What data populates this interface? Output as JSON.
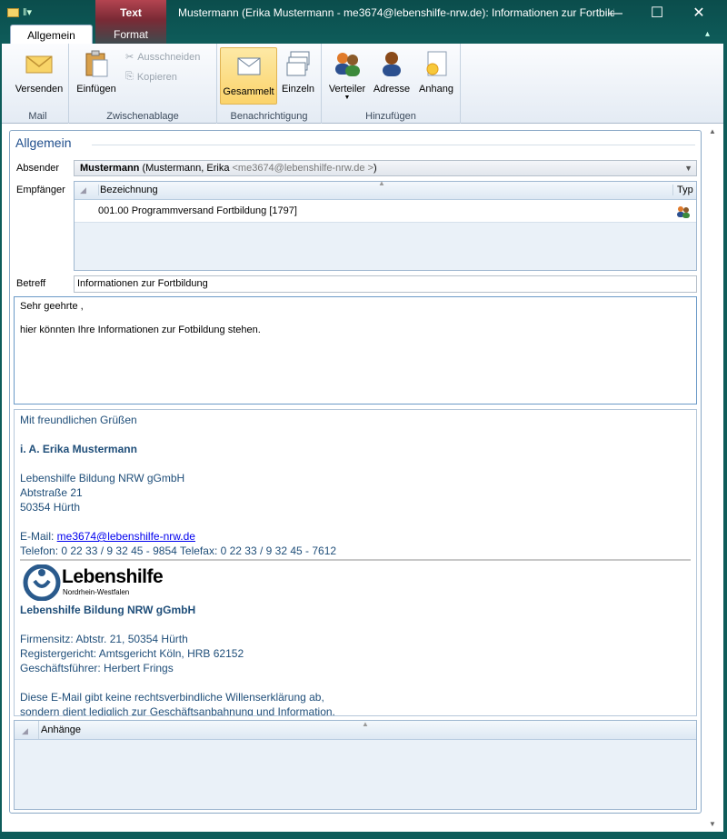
{
  "window": {
    "title": "Mustermann (Erika Mustermann - me3674@lebenshilfe-nrw.de): Informationen zur Fortbild...",
    "context_tab": "Text",
    "minimize": "—",
    "maximize": "☐",
    "close": "✕"
  },
  "tabs": {
    "allgemein": "Allgemein",
    "format": "Format"
  },
  "ribbon": {
    "mail": {
      "label": "Mail",
      "versenden": "Versenden"
    },
    "clipboard": {
      "label": "Zwischenablage",
      "einfuegen": "Einfügen",
      "ausschneiden": "Ausschneiden",
      "kopieren": "Kopieren"
    },
    "notify": {
      "label": "Benachrichtigung",
      "gesammelt": "Gesammelt",
      "einzeln": "Einzeln"
    },
    "add": {
      "label": "Hinzufügen",
      "verteiler": "Verteiler",
      "adresse": "Adresse",
      "anhang": "Anhang"
    }
  },
  "form": {
    "section_title": "Allgemein",
    "sender_label": "Absender",
    "sender_name": "Mustermann",
    "sender_detail": " (Mustermann, Erika ",
    "sender_addr": "<me3674@lebenshilfe-nrw.de >",
    "sender_close": ")",
    "recipient_label": "Empfänger",
    "col_bezeichnung": "Bezeichnung",
    "col_typ": "Typ",
    "recipient_row": "001.00 Programmversand Fortbildung [1797]",
    "subject_label": "Betreff",
    "subject_value": "Informationen zur Fortbildung",
    "body_line1": "Sehr geehrte ,",
    "body_line2": "hier könnten Ihre Informationen zur Fotbildung stehen.",
    "attachments_label": "Anhänge"
  },
  "signature": {
    "greeting": "Mit freundlichen Grüßen",
    "name": "i. A. Erika Mustermann",
    "org": "Lebenshilfe Bildung NRW gGmbH",
    "street": "Abtstraße 21",
    "city": "50354 Hürth",
    "email_label": "E-Mail:  ",
    "email": "me3674@lebenshilfe-nrw.de",
    "phone": "Telefon: 0 22 33 / 9 32 45 - 9854 Telefax: 0 22 33 / 9 32 45 - 7612",
    "logo_text": "Lebenshilfe",
    "logo_sub": "Nordrhein-Westfalen",
    "org_bold": "Lebenshilfe Bildung NRW gGmbH",
    "seat": "Firmensitz: Abtstr. 21, 50354 Hürth",
    "register": "Registergericht: Amtsgericht Köln, HRB 62152",
    "ceo": "Geschäftsführer: Herbert Frings",
    "disclaimer1": "Diese E-Mail gibt keine rechtsverbindliche Willenserklärung ab,",
    "disclaimer2": "sondern dient lediglich zur Geschäftsanbahnung und Information."
  }
}
